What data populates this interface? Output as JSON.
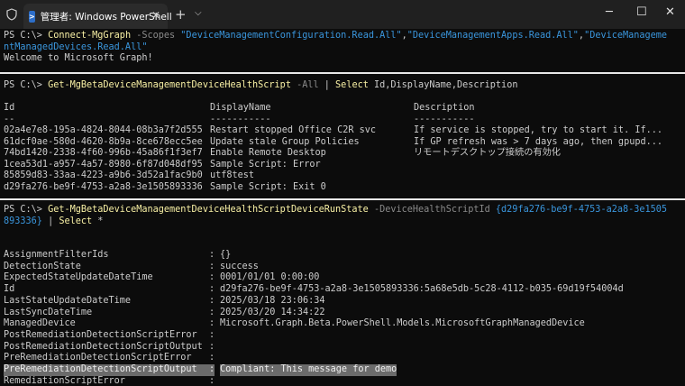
{
  "window": {
    "tab_title": "管理者: Windows PowerShell",
    "tab_icon": "powershell-icon",
    "accent": "#2d6ec9"
  },
  "pane1": {
    "prompt": "PS C:\\> ",
    "cmdlet": "Connect-MgGraph",
    "param": " -Scopes ",
    "scope1": "\"DeviceManagementConfiguration.Read.All\"",
    "comma1": ",",
    "scope2": "\"DeviceManagementApps.Read.All\"",
    "comma2": ",",
    "scope3a": "\"DeviceManageme",
    "scope3b": "ntManagedDevices.Read.All\"",
    "welcome": "Welcome to Microsoft Graph!"
  },
  "pane2": {
    "prompt": "PS C:\\> ",
    "cmdlet": "Get-MgBetaDeviceManagementDeviceHealthScript",
    "param": " -All ",
    "pipe": "| ",
    "select": "Select",
    "fields": " Id,DisplayName,Description",
    "headers": [
      "Id",
      "DisplayName",
      "Description"
    ],
    "underlines": [
      "--",
      "-----------",
      "-----------"
    ],
    "rows": [
      [
        "02a4e7e8-195a-4824-8044-08b3a7f2d555",
        "Restart stopped Office C2R svc",
        "If service is stopped, try to start it. If..."
      ],
      [
        "61dcf0ae-580d-4620-8b9a-8ce678ecc5ee",
        "Update stale Group Policies",
        "If GP refresh was > 7 days ago, then gpupd..."
      ],
      [
        "74bd1420-2338-4f60-996b-45a86f1f3ef7",
        "Enable Remote Desktop",
        "リモートデスクトップ接続の有効化"
      ],
      [
        "1cea53d1-a957-4a57-8980-6f87d048df95",
        "Sample Script: Error",
        ""
      ],
      [
        "85859d83-33aa-4223-a9b6-3d52a1fac9b0",
        "utf8test",
        ""
      ],
      [
        "d29fa276-be9f-4753-a2a8-3e1505893336",
        "Sample Script: Exit 0",
        ""
      ]
    ]
  },
  "pane3": {
    "prompt": "PS C:\\> ",
    "cmdlet": "Get-MgBetaDeviceManagementDeviceHealthScriptDeviceRunState",
    "param": " -DeviceHealthScriptId ",
    "id_part1": "{d29fa276-be9f-4753-a2a8-3e1505",
    "id_part2": "893336}",
    "pipe": " | ",
    "select": "Select",
    "star": " *",
    "properties": [
      {
        "name": "AssignmentFilterIds",
        "value": "{}"
      },
      {
        "name": "DetectionState",
        "value": "success"
      },
      {
        "name": "ExpectedStateUpdateDateTime",
        "value": "0001/01/01 0:00:00"
      },
      {
        "name": "Id",
        "value": "d29fa276-be9f-4753-a2a8-3e1505893336:5a68e5db-5c28-4112-b035-69d19f54004d"
      },
      {
        "name": "LastStateUpdateDateTime",
        "value": "2025/03/18 23:06:34"
      },
      {
        "name": "LastSyncDateTime",
        "value": "2025/03/20 14:34:22"
      },
      {
        "name": "ManagedDevice",
        "value": "Microsoft.Graph.Beta.PowerShell.Models.MicrosoftGraphManagedDevice"
      },
      {
        "name": "PostRemediationDetectionScriptError",
        "value": ""
      },
      {
        "name": "PostRemediationDetectionScriptOutput",
        "value": ""
      },
      {
        "name": "PreRemediationDetectionScriptError",
        "value": ""
      },
      {
        "name": "PreRemediationDetectionScriptOutput",
        "value": "Compliant: This message for demo"
      },
      {
        "name": "RemediationScriptError",
        "value": ""
      }
    ]
  }
}
